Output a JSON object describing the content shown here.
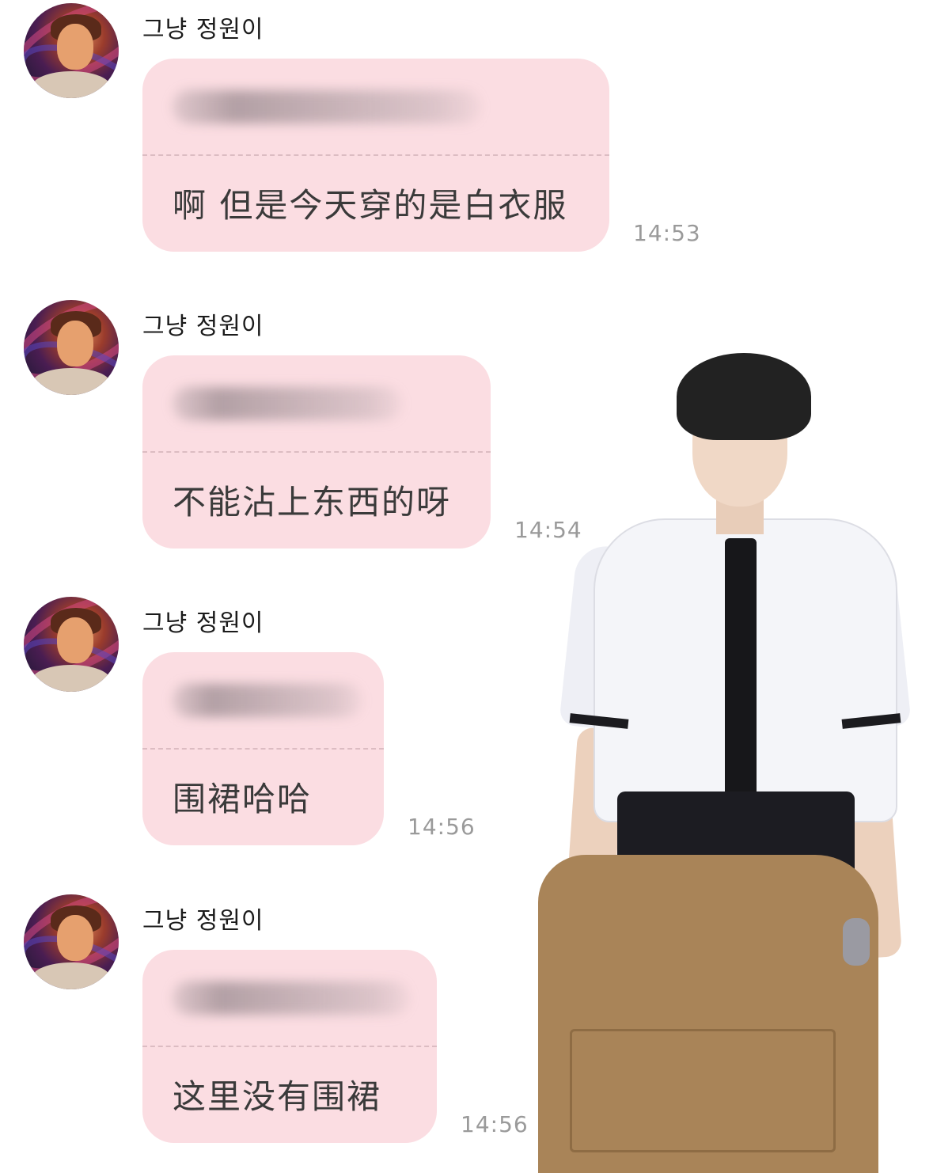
{
  "messages": [
    {
      "sender": "그냥 정원이",
      "text": "啊 但是今天穿的是白衣服",
      "time": "14:53"
    },
    {
      "sender": "그냥 정원이",
      "text": "不能沾上东西的呀",
      "time": "14:54"
    },
    {
      "sender": "그냥 정원이",
      "text": "围裙哈哈",
      "time": "14:56"
    },
    {
      "sender": "그냥 정원이",
      "text": "这里没有围裙",
      "time": "14:56"
    }
  ],
  "icons": {
    "avatar": "avatar-icon"
  },
  "colors": {
    "bubble": "#fbdde2",
    "divider": "#dcbcc2",
    "time": "#9a9a9a",
    "text": "#3a3a3a"
  }
}
